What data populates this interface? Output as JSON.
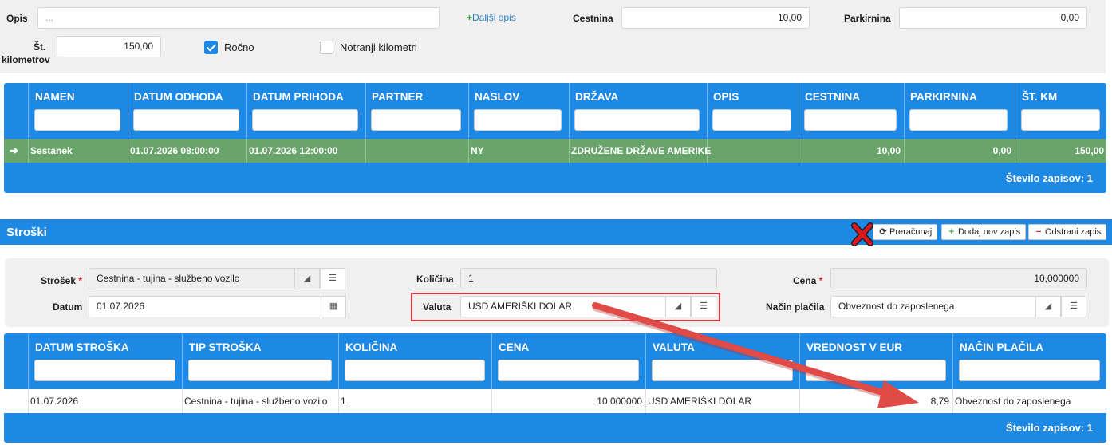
{
  "top_form": {
    "opis_label": "Opis",
    "opis_placeholder": "...",
    "add_opis": "Daljši opis",
    "cestnina_label": "Cestnina",
    "cestnina_value": "10,00",
    "parkirnina_label": "Parkirnina",
    "parkirnina_value": "0,00",
    "km_label_1": "Št.",
    "km_label_2": "kilometrov",
    "km_value": "150,00",
    "rocno_label": "Ročno",
    "rocno_checked": true,
    "notranji_label": "Notranji kilometri",
    "notranji_checked": false
  },
  "grid1": {
    "columns": [
      "NAMEN",
      "DATUM ODHODA",
      "DATUM PRIHODA",
      "PARTNER",
      "NASLOV",
      "DRŽAVA",
      "OPIS",
      "CESTNINA",
      "PARKIRNINA",
      "ŠT. KM"
    ],
    "rows": [
      [
        "Sestanek",
        "01.07.2026 08:00:00",
        "01.07.2026 12:00:00",
        "",
        "NY",
        "ZDRUŽENE DRŽAVE AMERIKE",
        "",
        "10,00",
        "0,00",
        "150,00"
      ]
    ],
    "footer": "Število zapisov: 1"
  },
  "stroski": {
    "title": "Stroški",
    "btn_recalc": "Preračunaj",
    "btn_add": "Dodaj nov zapis",
    "btn_remove": "Odstrani zapis"
  },
  "mid_form": {
    "strosek_label": "Strošek",
    "strosek_value": "Cestnina - tujina - službeno vozilo",
    "kolicina_label": "Količina",
    "kolicina_value": "1",
    "cena_label": "Cena",
    "cena_value": "10,000000",
    "datum_label": "Datum",
    "datum_value": "01.07.2026",
    "valuta_label": "Valuta",
    "valuta_value": "USD AMERIŠKI DOLAR",
    "nacin_label": "Način plačila",
    "nacin_value": "Obveznost do zaposlenega"
  },
  "grid2": {
    "columns": [
      "DATUM STROŠKA",
      "TIP STROŠKA",
      "KOLIČINA",
      "CENA",
      "VALUTA",
      "VREDNOST V EUR",
      "NAČIN PLAČILA"
    ],
    "rows": [
      [
        "01.07.2026",
        "Cestnina - tujina - službeno vozilo",
        "1",
        "10,000000",
        "USD AMERIŠKI DOLAR",
        "8,79",
        "Obveznost do zaposlenega"
      ]
    ],
    "footer": "Število zapisov: 1"
  },
  "colors": {
    "accent": "#1e88e5",
    "row_selected": "#69a56b",
    "highlight_red": "#d9383f"
  }
}
